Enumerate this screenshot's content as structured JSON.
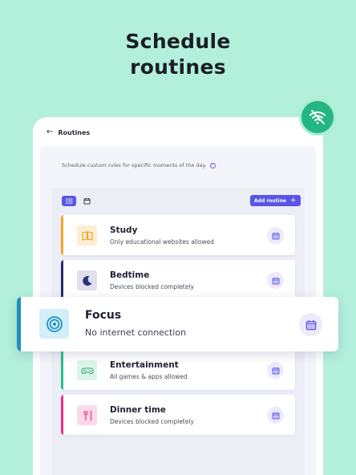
{
  "headline": {
    "line1": "Schedule",
    "line2": "routines"
  },
  "header": {
    "back_icon": "arrow-left-icon",
    "title": "Routines"
  },
  "description": {
    "text": "Schedule custom rules for specific moments of the day.",
    "info_icon": "info-icon"
  },
  "toolbar": {
    "views": [
      {
        "icon": "list-icon",
        "selected": true
      },
      {
        "icon": "calendar-icon",
        "selected": false
      }
    ],
    "add_button": "Add routine",
    "add_icon": "plus-icon"
  },
  "colors": {
    "background": "#b3f0dc",
    "accent": "#5b55e6",
    "badge": "#24b583"
  },
  "routines": [
    {
      "title": "Study",
      "subtitle": "Only educational websites allowed",
      "icon": "book-icon",
      "stripe": "#f4a52d",
      "icon_bg": "#fdeed3",
      "icon_color": "#f0a326"
    },
    {
      "title": "Bedtime",
      "subtitle": "Devices blocked completely",
      "icon": "moon-icon",
      "stripe": "#252c6e",
      "icon_bg": "#dfe0ee",
      "icon_color": "#2b3276"
    },
    {
      "title": "Focus",
      "subtitle": "No internet connection",
      "icon": "target-icon",
      "stripe": "#1e91bf",
      "icon_bg": "#d2eef8",
      "icon_color": "#1e91bf"
    },
    {
      "title": "Entertainment",
      "subtitle": "All games & apps allowed",
      "icon": "gamepad-icon",
      "stripe": "#2fbf84",
      "icon_bg": "#dbf4e9",
      "icon_color": "#2fa877"
    },
    {
      "title": "Dinner time",
      "subtitle": "Devices blocked completely",
      "icon": "utensils-icon",
      "stripe": "#ee2f86",
      "icon_bg": "#fcd9ea",
      "icon_color": "#e8327f"
    }
  ],
  "schedule_icon": "calendar-icon",
  "badge_icon": "wifi-off-icon"
}
